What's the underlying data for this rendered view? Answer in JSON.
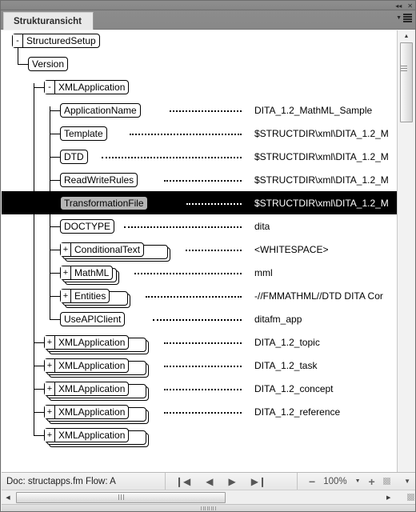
{
  "window": {
    "title_icons": [
      {
        "name": "collapse-to-icons-icon",
        "glyph": "◂◂"
      },
      {
        "name": "close-icon",
        "glyph": "✕"
      }
    ]
  },
  "tabs": [
    {
      "label": "Strukturansicht",
      "active": true
    }
  ],
  "panel_menu": {
    "label": "Panel Menu"
  },
  "tree": {
    "rows": [
      {
        "label": "StructuredSetup",
        "toggle": "-",
        "depth": 0,
        "stacked": false,
        "selected": false,
        "leader": "",
        "value": ""
      },
      {
        "label": "Version",
        "toggle": "",
        "depth": 1,
        "stacked": false,
        "selected": false,
        "leader": "",
        "value": ""
      },
      {
        "label": "XMLApplication",
        "toggle": "-",
        "depth": 2,
        "stacked": false,
        "selected": false,
        "leader": "",
        "value": ""
      },
      {
        "label": "ApplicationName",
        "toggle": "",
        "depth": 3,
        "stacked": false,
        "selected": false,
        "leader": "⋯",
        "value": "DITA_1.2_MathML_Sample"
      },
      {
        "label": "Template",
        "toggle": "",
        "depth": 3,
        "stacked": false,
        "selected": false,
        "leader": "⋯",
        "value": "$STRUCTDIR\\xml\\DITA_1.2_M"
      },
      {
        "label": "DTD",
        "toggle": "",
        "depth": 3,
        "stacked": false,
        "selected": false,
        "leader": "⋯",
        "value": "$STRUCTDIR\\xml\\DITA_1.2_M"
      },
      {
        "label": "ReadWriteRules",
        "toggle": "",
        "depth": 3,
        "stacked": false,
        "selected": false,
        "leader": "⋯",
        "value": "$STRUCTDIR\\xml\\DITA_1.2_M"
      },
      {
        "label": "TransformationFile",
        "toggle": "",
        "depth": 3,
        "stacked": false,
        "selected": true,
        "leader": "⋯",
        "value": "$STRUCTDIR\\xml\\DITA_1.2_M"
      },
      {
        "label": "DOCTYPE",
        "toggle": "",
        "depth": 3,
        "stacked": false,
        "selected": false,
        "leader": "⋯",
        "value": "dita"
      },
      {
        "label": "ConditionalText",
        "toggle": "+",
        "depth": 3,
        "stacked": true,
        "selected": false,
        "leader": "⋯",
        "value": "<WHITESPACE>"
      },
      {
        "label": "MathML",
        "toggle": "+",
        "depth": 3,
        "stacked": true,
        "selected": false,
        "leader": "⋯",
        "value": "mml"
      },
      {
        "label": "Entities",
        "toggle": "+",
        "depth": 3,
        "stacked": true,
        "selected": false,
        "leader": "⋯",
        "value": "-//FMMATHML//DTD DITA Cor"
      },
      {
        "label": "UseAPIClient",
        "toggle": "",
        "depth": 3,
        "stacked": false,
        "selected": false,
        "leader": "⋯",
        "value": "ditafm_app"
      },
      {
        "label": "XMLApplication",
        "toggle": "+",
        "depth": 2,
        "stacked": true,
        "selected": false,
        "leader": "⋯",
        "value": "DITA_1.2_topic"
      },
      {
        "label": "XMLApplication",
        "toggle": "+",
        "depth": 2,
        "stacked": true,
        "selected": false,
        "leader": "⋯",
        "value": "DITA_1.2_task"
      },
      {
        "label": "XMLApplication",
        "toggle": "+",
        "depth": 2,
        "stacked": true,
        "selected": false,
        "leader": "⋯",
        "value": "DITA_1.2_concept"
      },
      {
        "label": "XMLApplication",
        "toggle": "+",
        "depth": 2,
        "stacked": true,
        "selected": false,
        "leader": "⋯",
        "value": "DITA_1.2_reference"
      },
      {
        "label": "XMLApplication",
        "toggle": "+",
        "depth": 2,
        "stacked": true,
        "selected": false,
        "leader": "",
        "value": ""
      }
    ]
  },
  "scrollbars": {
    "vertical": {
      "up_arrow": "▲",
      "thumb_position": "top"
    },
    "horizontal": {
      "left_arrow": "◀",
      "right_arrow": "▶"
    }
  },
  "statusbar": {
    "doc_text": "Doc: structapps.fm  Flow: A",
    "nav": [
      {
        "name": "first-page-button",
        "glyph": "❙◀"
      },
      {
        "name": "previous-page-button",
        "glyph": "◀"
      },
      {
        "name": "next-page-button",
        "glyph": "▶"
      },
      {
        "name": "last-page-button",
        "glyph": "▶❙"
      }
    ],
    "zoom": {
      "minus": "−",
      "value": "100%",
      "dropdown": "▼",
      "plus": "+"
    },
    "collapse_arrow": "▼"
  },
  "colors": {
    "chrome": "#8a8a8a",
    "tab_active_bg": "#e9e9e9",
    "canvas_bg": "#ffffff",
    "selection_bg": "#000000",
    "selection_node_bg": "#b5b5b5",
    "text": "#000000",
    "statusbar_text": "#1f1f1f"
  }
}
